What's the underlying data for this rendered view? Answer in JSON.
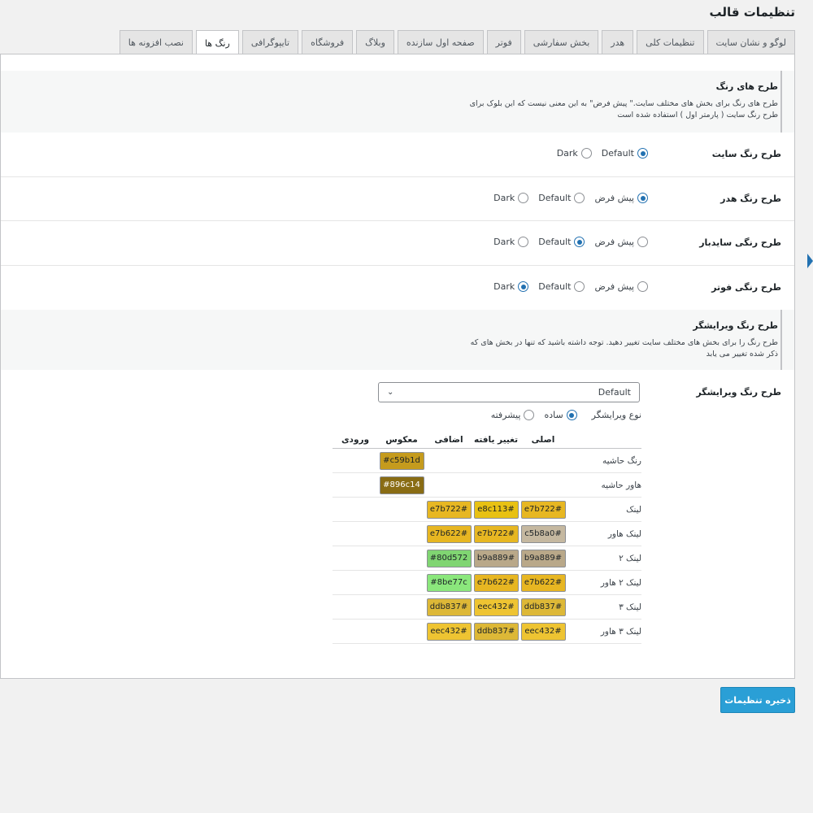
{
  "page_title": "تنظیمات قالب",
  "tabs": [
    {
      "label": "لوگو و نشان سایت",
      "active": false
    },
    {
      "label": "تنظیمات کلی",
      "active": false
    },
    {
      "label": "هدر",
      "active": false
    },
    {
      "label": "بخش سفارشی",
      "active": false
    },
    {
      "label": "فوتر",
      "active": false
    },
    {
      "label": "صفحه اول سازنده",
      "active": false
    },
    {
      "label": "وبلاگ",
      "active": false
    },
    {
      "label": "فروشگاه",
      "active": false
    },
    {
      "label": "تایپوگرافی",
      "active": false
    },
    {
      "label": "رنگ ها",
      "active": true
    },
    {
      "label": "نصب افزونه ها",
      "active": false
    }
  ],
  "section_colors": {
    "title": "طرح های رنگ",
    "desc_line1": "طرح های رنگ برای بخش های مختلف سایت.\" پیش فرض\" به این معنی نیست که این بلوک برای",
    "desc_line2": "طرح رنگ سایت ( پارمتر اول ) استفاده شده است"
  },
  "site_scheme": {
    "label": "طرح رنگ سایت",
    "options": [
      {
        "label": "Default",
        "checked": true
      },
      {
        "label": "Dark",
        "checked": false
      }
    ]
  },
  "header_scheme": {
    "label": "طرح رنگ هدر",
    "options": [
      {
        "label": "پیش فرض",
        "checked": true
      },
      {
        "label": "Default",
        "checked": false
      },
      {
        "label": "Dark",
        "checked": false
      }
    ]
  },
  "sidebar_scheme": {
    "label": "طرح رنگی سایدبار",
    "options": [
      {
        "label": "پیش فرض",
        "checked": false
      },
      {
        "label": "Default",
        "checked": true
      },
      {
        "label": "Dark",
        "checked": false
      }
    ]
  },
  "footer_scheme": {
    "label": "طرح رنگی فوتر",
    "options": [
      {
        "label": "پیش فرض",
        "checked": false
      },
      {
        "label": "Default",
        "checked": false
      },
      {
        "label": "Dark",
        "checked": true
      }
    ]
  },
  "section_editor": {
    "title": "طرح رنگ ویرایشگر",
    "desc_line1": "طرح رنگ را برای بخش های مختلف سایت تغییر دهید. توجه داشته باشید که تنها در بخش های که",
    "desc_line2": "ذکر شده تغییر می یابد"
  },
  "editor_scheme": {
    "label": "طرح رنگ ویرایشگر",
    "select_value": "Default",
    "type_label": "نوع ویرایشگر",
    "type_options": [
      {
        "label": "ساده",
        "checked": true
      },
      {
        "label": "پیشرفته",
        "checked": false
      }
    ]
  },
  "color_table": {
    "headers": [
      "اصلی",
      "تغییر یافته",
      "اضافی",
      "معکوس",
      "ورودی"
    ],
    "rows": [
      {
        "label": "رنگ حاشیه",
        "cells": [
          null,
          null,
          null,
          {
            "text": "c59b1d#",
            "color": "#c59b1d"
          },
          null
        ]
      },
      {
        "label": "هاور حاشیه",
        "cells": [
          null,
          null,
          null,
          {
            "text": "#896c14",
            "color": "#896c14",
            "dark": true
          },
          null
        ]
      },
      {
        "label": "لینک",
        "cells": [
          {
            "text": "e7b722#",
            "color": "#e7b722"
          },
          {
            "text": "e8c113#",
            "color": "#e8c113"
          },
          {
            "text": "e7b722#",
            "color": "#e7b722"
          },
          null,
          null
        ]
      },
      {
        "label": "لینک هاور",
        "cells": [
          {
            "text": "c5b8a0#",
            "color": "#c5b8a0"
          },
          {
            "text": "e7b722#",
            "color": "#e7b722"
          },
          {
            "text": "e7b622#",
            "color": "#e7b622"
          },
          null,
          null
        ]
      },
      {
        "label": "لینک ۲",
        "cells": [
          {
            "text": "b9a889#",
            "color": "#b9a889"
          },
          {
            "text": "b9a889#",
            "color": "#b9a889"
          },
          {
            "text": "#80d572",
            "color": "#80d572"
          },
          null,
          null
        ]
      },
      {
        "label": "لینک ۲ هاور",
        "cells": [
          {
            "text": "e7b622#",
            "color": "#e7b622"
          },
          {
            "text": "e7b622#",
            "color": "#e7b622"
          },
          {
            "text": "#8be77c",
            "color": "#8be77c"
          },
          null,
          null
        ]
      },
      {
        "label": "لینک ۳",
        "cells": [
          {
            "text": "ddb837#",
            "color": "#ddb837"
          },
          {
            "text": "eec432#",
            "color": "#eec432"
          },
          {
            "text": "ddb837#",
            "color": "#ddb837"
          },
          null,
          null
        ]
      },
      {
        "label": "لینک ۳ هاور",
        "cells": [
          {
            "text": "eec432#",
            "color": "#eec432"
          },
          {
            "text": "ddb837#",
            "color": "#ddb837"
          },
          {
            "text": "eec432#",
            "color": "#eec432"
          },
          null,
          null
        ]
      }
    ]
  },
  "save_label": "ذخیره تنظیمات"
}
